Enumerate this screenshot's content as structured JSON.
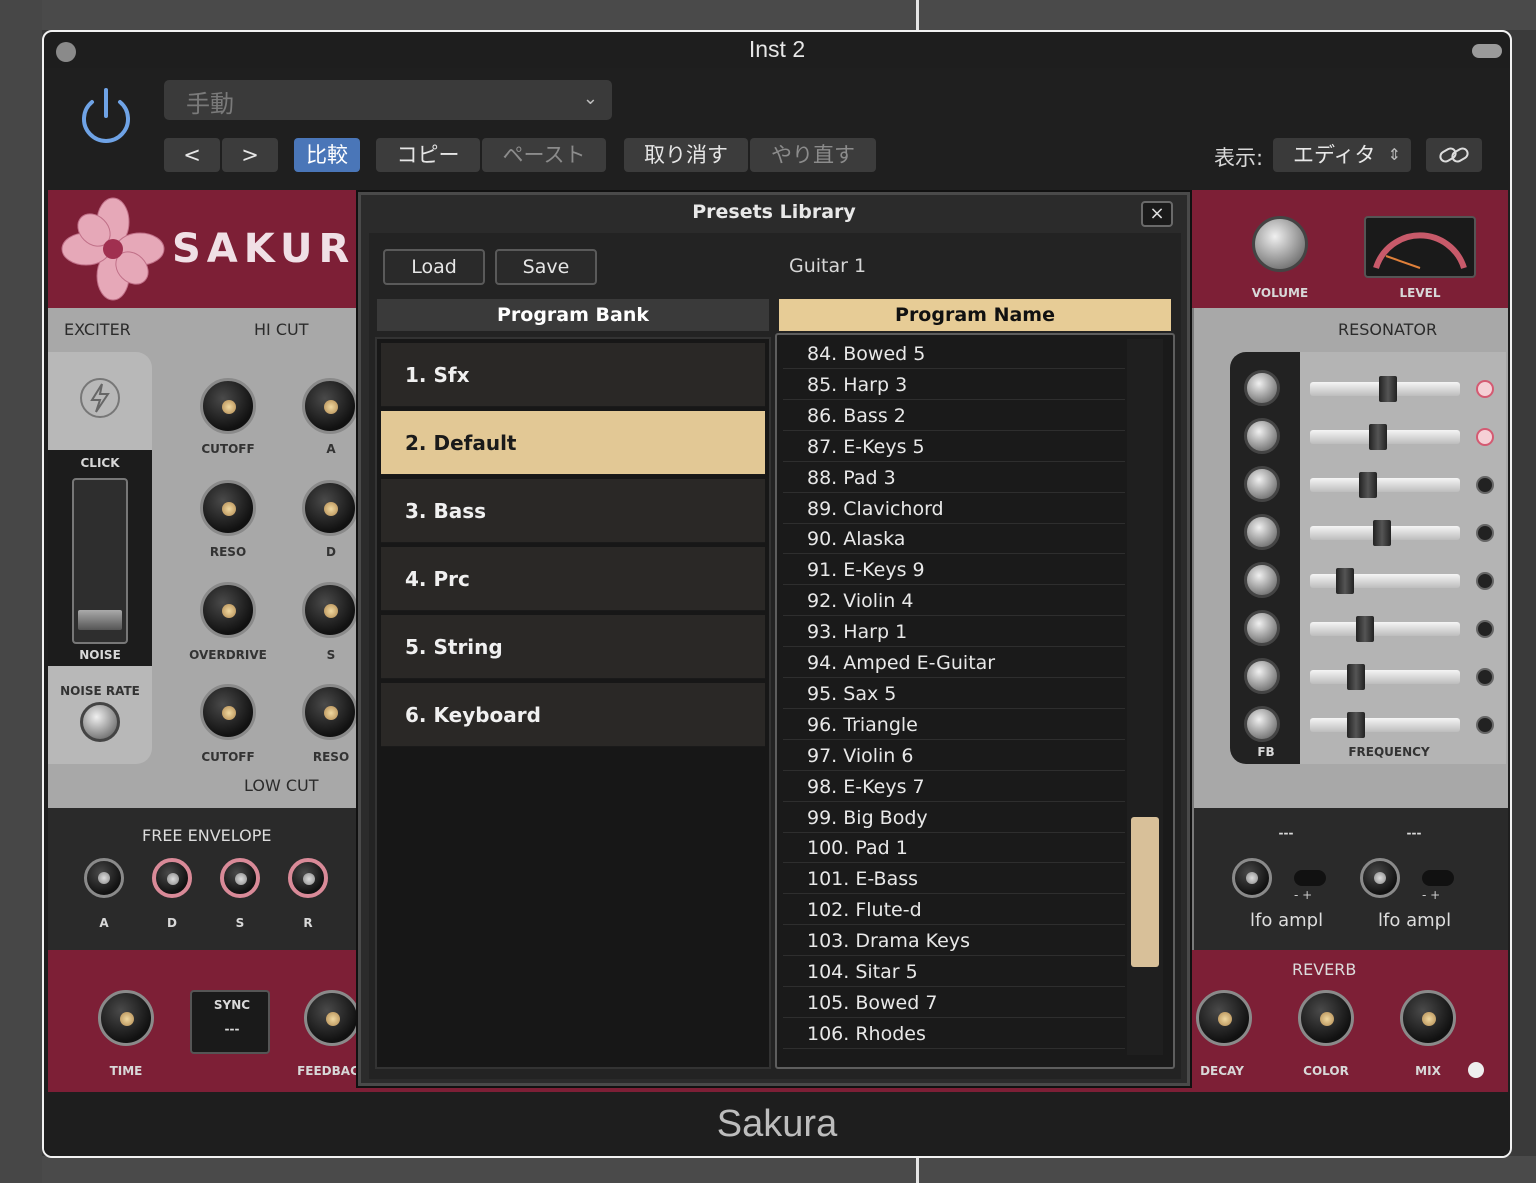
{
  "window": {
    "title": "Inst 2",
    "footer_title": "Sakura"
  },
  "header": {
    "preset_dropdown": "手動",
    "prev_label": "<",
    "next_label": ">",
    "compare_label": "比較",
    "copy_label": "コピー",
    "paste_label": "ペースト",
    "undo_label": "取り消す",
    "redo_label": "やり直す",
    "view_label": "表示:",
    "view_value": "エディタ"
  },
  "plugin": {
    "logo_text": "SAKUR",
    "exciter_label": "EXCITER",
    "hicut_label": "HI CUT",
    "lowcut_label": "LOW CUT",
    "click_label": "CLICK",
    "noise_label": "NOISE",
    "noise_rate_label": "NOISE RATE",
    "knobs": {
      "cutoff1": "CUTOFF",
      "a": "A",
      "reso1": "RESO",
      "d": "D",
      "overdrive": "OVERDRIVE",
      "s": "S",
      "cutoff2": "CUTOFF",
      "reso2": "RESO"
    },
    "free_envelope_label": "FREE ENVELOPE",
    "env_knobs": [
      "A",
      "D",
      "S",
      "R"
    ],
    "time_label": "TIME",
    "sync_label": "SYNC",
    "sync_value": "---",
    "feedback_label": "FEEDBAC",
    "volume_label": "VOLUME",
    "level_label": "LEVEL",
    "resonator_label": "RESONATOR",
    "fb_label": "FB",
    "frequency_label": "FREQUENCY",
    "lfo1_head": "---",
    "lfo2_head": "---",
    "lfo_ampl_1": "lfo ampl",
    "lfo_ampl_2": "lfo ampl",
    "minus_plus": "- +",
    "reverb_label": "REVERB",
    "decay_label": "DECAY",
    "color_label": "COLOR",
    "mix_label": "MIX",
    "resonator_rows": [
      {
        "thumb": 0.52,
        "led": "on"
      },
      {
        "thumb": 0.45,
        "led": "on"
      },
      {
        "thumb": 0.37,
        "led": "off"
      },
      {
        "thumb": 0.48,
        "led": "off"
      },
      {
        "thumb": 0.2,
        "led": "off"
      },
      {
        "thumb": 0.35,
        "led": "off"
      },
      {
        "thumb": 0.28,
        "led": "off"
      },
      {
        "thumb": 0.28,
        "led": "off"
      }
    ]
  },
  "presets_dialog": {
    "title": "Presets Library",
    "close_label": "×",
    "load_label": "Load",
    "save_label": "Save",
    "current_program": "Guitar 1",
    "bank_header": "Program Bank",
    "name_header": "Program Name",
    "banks": [
      {
        "label": "1. Sfx",
        "selected": false
      },
      {
        "label": "2. Default",
        "selected": true
      },
      {
        "label": "3. Bass",
        "selected": false
      },
      {
        "label": "4. Prc",
        "selected": false
      },
      {
        "label": "5. String",
        "selected": false
      },
      {
        "label": "6. Keyboard",
        "selected": false
      }
    ],
    "programs": [
      "84. Bowed 5",
      "85. Harp 3",
      "86. Bass 2",
      "87. E-Keys 5",
      "88. Pad 3",
      "89. Clavichord",
      "90. Alaska",
      "91. E-Keys 9",
      "92. Violin 4",
      "93. Harp 1",
      "94. Amped E-Guitar",
      "95. Sax 5",
      "96. Triangle",
      "97. Violin 6",
      "98. E-Keys 7",
      "99. Big Body",
      "100. Pad 1",
      "101. E-Bass",
      "102. Flute-d",
      "103. Drama Keys",
      "104. Sitar 5",
      "105. Bowed 7",
      "106. Rhodes"
    ],
    "scroll_position": 0.85
  },
  "colors": {
    "accent_blue": "#4a76b8",
    "selection_tan": "#e2c895",
    "plugin_red": "#7d1f36"
  }
}
